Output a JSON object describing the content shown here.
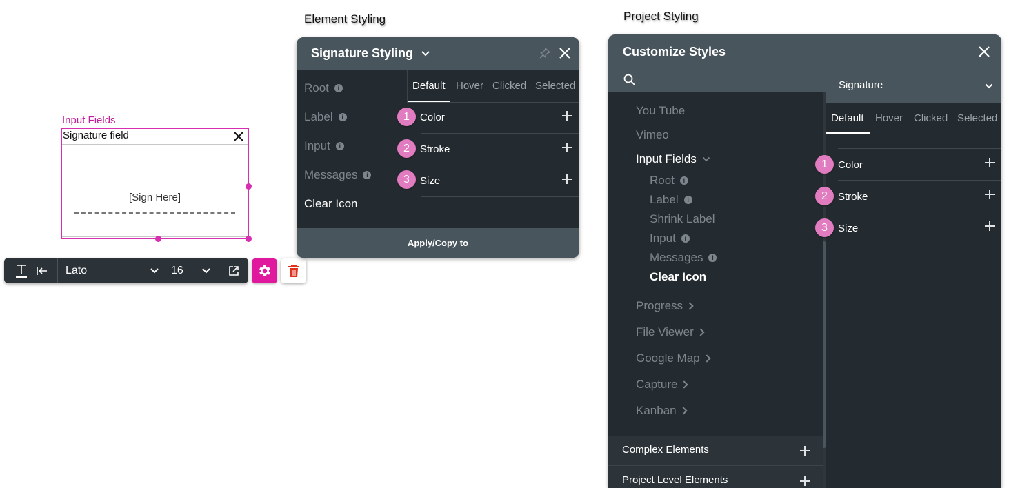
{
  "captions": {
    "element_styling": "Element Styling",
    "project_styling": "Project Styling"
  },
  "canvas": {
    "section_label": "Input Fields",
    "signature_field_title": "Signature field",
    "sign_here": "[Sign Here]",
    "colors": {
      "selection": "#d72fb0",
      "accent": "#e0189d"
    }
  },
  "toolbar": {
    "font_family": "Lato",
    "font_size": "16",
    "icons": [
      "text-color-icon",
      "align-left-icon",
      "chevron-down-icon",
      "external-link-icon",
      "gear-icon",
      "trash-icon"
    ]
  },
  "element_styling": {
    "title": "Signature Styling",
    "sidebar": [
      {
        "label": "Root",
        "info": true
      },
      {
        "label": "Label",
        "info": true
      },
      {
        "label": "Input",
        "info": true
      },
      {
        "label": "Messages",
        "info": true
      },
      {
        "label": "Clear Icon",
        "info": false
      }
    ],
    "tabs": [
      "Default",
      "Hover",
      "Clicked",
      "Selected"
    ],
    "properties": [
      {
        "num": "1",
        "label": "Color"
      },
      {
        "num": "2",
        "label": "Stroke"
      },
      {
        "num": "3",
        "label": "Size"
      }
    ],
    "footer": "Apply/Copy to"
  },
  "project_styling": {
    "title": "Customize Styles",
    "selected_element": "Signature",
    "tree": {
      "you_tube": "You Tube",
      "vimeo": "Vimeo",
      "input_fields": "Input Fields",
      "children": [
        "Root",
        "Label",
        "Shrink Label",
        "Input",
        "Messages",
        "Clear Icon"
      ],
      "after": [
        "Progress",
        "File Viewer",
        "Google Map",
        "Capture",
        "Kanban"
      ]
    },
    "tabs": [
      "Default",
      "Hover",
      "Clicked",
      "Selected"
    ],
    "properties": [
      {
        "num": "1",
        "label": "Color"
      },
      {
        "num": "2",
        "label": "Stroke"
      },
      {
        "num": "3",
        "label": "Size"
      }
    ],
    "bottom_sections": [
      "Complex Elements",
      "Project Level Elements"
    ]
  }
}
